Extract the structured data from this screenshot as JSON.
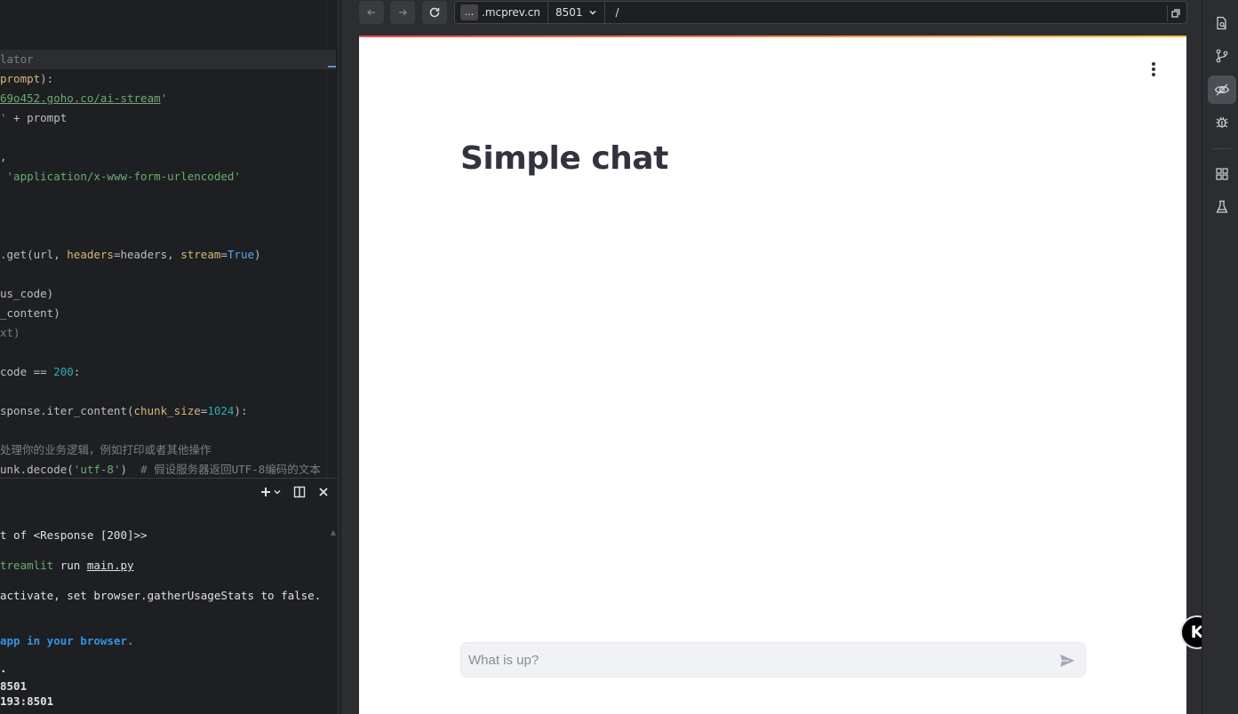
{
  "editor": {
    "lines": [
      {
        "t": [
          {
            "c": "tok-dim",
            "v": "lator"
          }
        ]
      },
      {
        "t": [
          {
            "c": "tok-param",
            "v": "prompt"
          },
          {
            "c": "",
            "v": "):"
          }
        ]
      },
      {
        "t": [
          {
            "c": "tok-link",
            "v": "69o452.goho.co/ai-stream"
          },
          {
            "c": "tok-str",
            "v": "'"
          }
        ]
      },
      {
        "t": [
          {
            "c": "tok-str",
            "v": "'"
          },
          {
            "c": "",
            "v": " + prompt"
          }
        ]
      },
      {
        "t": []
      },
      {
        "t": [
          {
            "c": "",
            "v": ","
          }
        ]
      },
      {
        "t": [
          {
            "c": "",
            "v": " "
          },
          {
            "c": "tok-str",
            "v": "'application/x-www-form-urlencoded'"
          }
        ]
      },
      {
        "t": []
      },
      {
        "t": []
      },
      {
        "t": []
      },
      {
        "t": [
          {
            "c": "",
            "v": ".get(url, "
          },
          {
            "c": "tok-param",
            "v": "headers"
          },
          {
            "c": "",
            "v": "=headers, "
          },
          {
            "c": "tok-param",
            "v": "stream"
          },
          {
            "c": "",
            "v": "="
          },
          {
            "c": "tok-true",
            "v": "True"
          },
          {
            "c": "",
            "v": ")"
          }
        ]
      },
      {
        "t": []
      },
      {
        "t": [
          {
            "c": "",
            "v": "us_code)"
          }
        ]
      },
      {
        "t": [
          {
            "c": "",
            "v": "_content)"
          }
        ]
      },
      {
        "t": [
          {
            "c": "tok-dim",
            "v": "xt)"
          }
        ]
      },
      {
        "t": []
      },
      {
        "t": [
          {
            "c": "",
            "v": "code == "
          },
          {
            "c": "tok-num",
            "v": "200"
          },
          {
            "c": "",
            "v": ":"
          }
        ]
      },
      {
        "t": []
      },
      {
        "t": [
          {
            "c": "",
            "v": "sponse.iter_content("
          },
          {
            "c": "tok-param",
            "v": "chunk_size"
          },
          {
            "c": "",
            "v": "="
          },
          {
            "c": "tok-num",
            "v": "1024"
          },
          {
            "c": "",
            "v": "):"
          }
        ]
      },
      {
        "t": []
      },
      {
        "t": [
          {
            "c": "tok-comment",
            "v": "处理你的业务逻辑，例如打印或者其他操作"
          }
        ]
      },
      {
        "t": [
          {
            "c": "",
            "v": "unk.decode("
          },
          {
            "c": "tok-str",
            "v": "'utf-8'"
          },
          {
            "c": "",
            "v": ")  "
          },
          {
            "c": "tok-comment",
            "v": "# 假设服务器返回UTF-8编码的文本"
          }
        ]
      }
    ]
  },
  "terminal": {
    "lines": [
      {
        "t": [
          {
            "c": "",
            "v": "t of <Response [200]>>"
          }
        ]
      },
      {
        "t": [
          {
            "c": "term-green",
            "v": "treamlit"
          },
          {
            "c": "",
            "v": " run "
          },
          {
            "c": "term-under",
            "v": "main.py"
          }
        ]
      },
      {
        "t": [
          {
            "c": "",
            "v": "activate, set browser.gatherUsageStats to false."
          }
        ]
      },
      {
        "t": [
          {
            "c": "term-blue",
            "v": "app in your browser."
          }
        ]
      },
      {
        "t": [
          {
            "c": "term-bold",
            "v": "."
          }
        ]
      },
      {
        "t": [
          {
            "c": "term-bold",
            "v": "8501"
          }
        ]
      },
      {
        "t": [
          {
            "c": "term-bold",
            "v": "193:8501"
          }
        ]
      }
    ]
  },
  "browser": {
    "back_icon": "arrow-left-icon",
    "forward_icon": "arrow-right-icon",
    "reload_icon": "reload-icon",
    "url_more_label": "...",
    "url_host": ".mcprev.cn",
    "url_port": "8501",
    "url_path": "/"
  },
  "page": {
    "title": "Simple chat",
    "chat_placeholder": "What is up?",
    "accent_gradient": [
      "#ff4b4b",
      "#ffbd45"
    ]
  },
  "badge": {
    "label": "K"
  },
  "strip": {
    "icons": [
      "file-search-icon",
      "git-branch-icon",
      "eye-icon",
      "bug-icon",
      "grid-icon",
      "flask-icon"
    ]
  }
}
